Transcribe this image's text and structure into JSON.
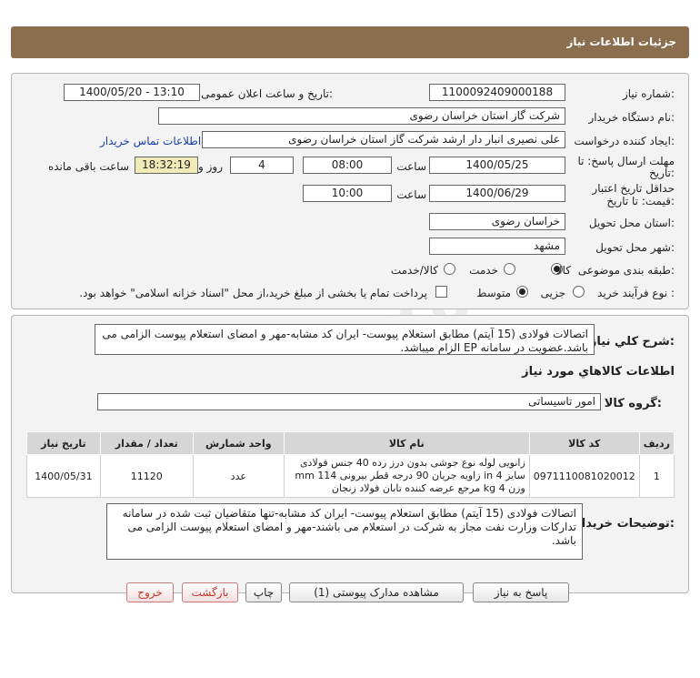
{
  "header": {
    "title": "جزئیات اطلاعات نیاز"
  },
  "form": {
    "need_number": {
      "label": "شماره نیاز:",
      "value": "1100092409000188"
    },
    "announce": {
      "label": "تاریخ و ساعت اعلان عمومی:",
      "value": "1400/05/20 - 13:10"
    },
    "buyer_org": {
      "label": "نام دستگاه خریدار:",
      "value": "شرکت گاز استان خراسان رضوی"
    },
    "requester": {
      "label": "ایجاد کننده درخواست:",
      "value": "علی نصیری انبار دار  ارشد شرکت گاز استان خراسان رضوی",
      "contact_link": "اطلاعات تماس خریدار"
    },
    "reply_deadline": {
      "label_line1": "مهلت ارسال پاسخ: تا",
      "label_line2": "تاریخ:",
      "date": "1400/05/25",
      "time_label": "ساعت",
      "time": "08:00",
      "days": "4",
      "days_label": "روز و",
      "remaining": "18:32:19",
      "remaining_label": "ساعت باقی مانده"
    },
    "validity": {
      "label_line1": "حداقل تاریخ اعتبار",
      "label_line2": "قیمت: تا تاریخ:",
      "date": "1400/06/29",
      "time_label": "ساعت",
      "time": "10:00"
    },
    "delivery_province": {
      "label": "استان محل تحویل:",
      "value": "خراسان رضوی"
    },
    "delivery_city": {
      "label": "شهر محل تحویل:",
      "value": "مشهد"
    },
    "category": {
      "label": "طبقه بندی موضوعی:",
      "options": [
        "کالا",
        "خدمت",
        "کالا/خدمت"
      ],
      "selected": "کالا"
    },
    "process": {
      "label": "نوع فرآیند خرید :",
      "options": [
        "جزیی",
        "متوسط"
      ],
      "selected": "متوسط",
      "payment_note": "پرداخت تمام یا بخشی از مبلغ خرید،از محل \"اسناد خزانه اسلامی\" خواهد بود."
    }
  },
  "description": {
    "label": "شرح کلي نياز:",
    "text": "اتصالات فولادی (15 آیتم) مطابق استعلام پیوست- ایران کد مشابه-مهر و امضای استعلام پیوست الزامی می باشد.عضویت در سامانه EP الزام میباشد."
  },
  "goods": {
    "title": "اطلاعات کالاهاي مورد نياز",
    "group_label": "گروه کالا:",
    "group_value": "امور تاسیساتی",
    "columns": [
      "ردیف",
      "کد کالا",
      "نام کالا",
      "واحد شمارش",
      "تعداد / مقدار",
      "تاریخ نیاز"
    ],
    "rows": [
      {
        "index": "1",
        "code": "0971110081020012",
        "name": "زانویی لوله نوع جوشی بدون درز رده 40 جنس فولادی سایز 4 in زاویه جریان 90 درجه قطر بیرونی 114 mm وزن 4 kg مرجع عرضه کننده تابان فولاد زنجان",
        "unit": "عدد",
        "qty": "11120",
        "date": "1400/05/31"
      }
    ]
  },
  "buyer_notes": {
    "label": "توضیحات خریدار:",
    "text": "اتصالات فولادی (15 آیتم) مطابق استعلام پیوست- ایران کد مشابه-تنها متقاضیان ثبت شده در سامانه تدارکات وزارت نفت مجاز به شرکت در استعلام می باشند-مهر و امضای استعلام پیوست الزامی می باشد."
  },
  "buttons": {
    "reply": "پاسخ به نیاز",
    "view_docs": "مشاهده مدارک پیوستی (1)",
    "print": "چاپ",
    "back": "بازگشت",
    "exit": "خروج"
  },
  "colors": {
    "header_bg": "#8a6e4e",
    "remaining_bg": "#f0eab6",
    "link": "#1a3ea8"
  }
}
